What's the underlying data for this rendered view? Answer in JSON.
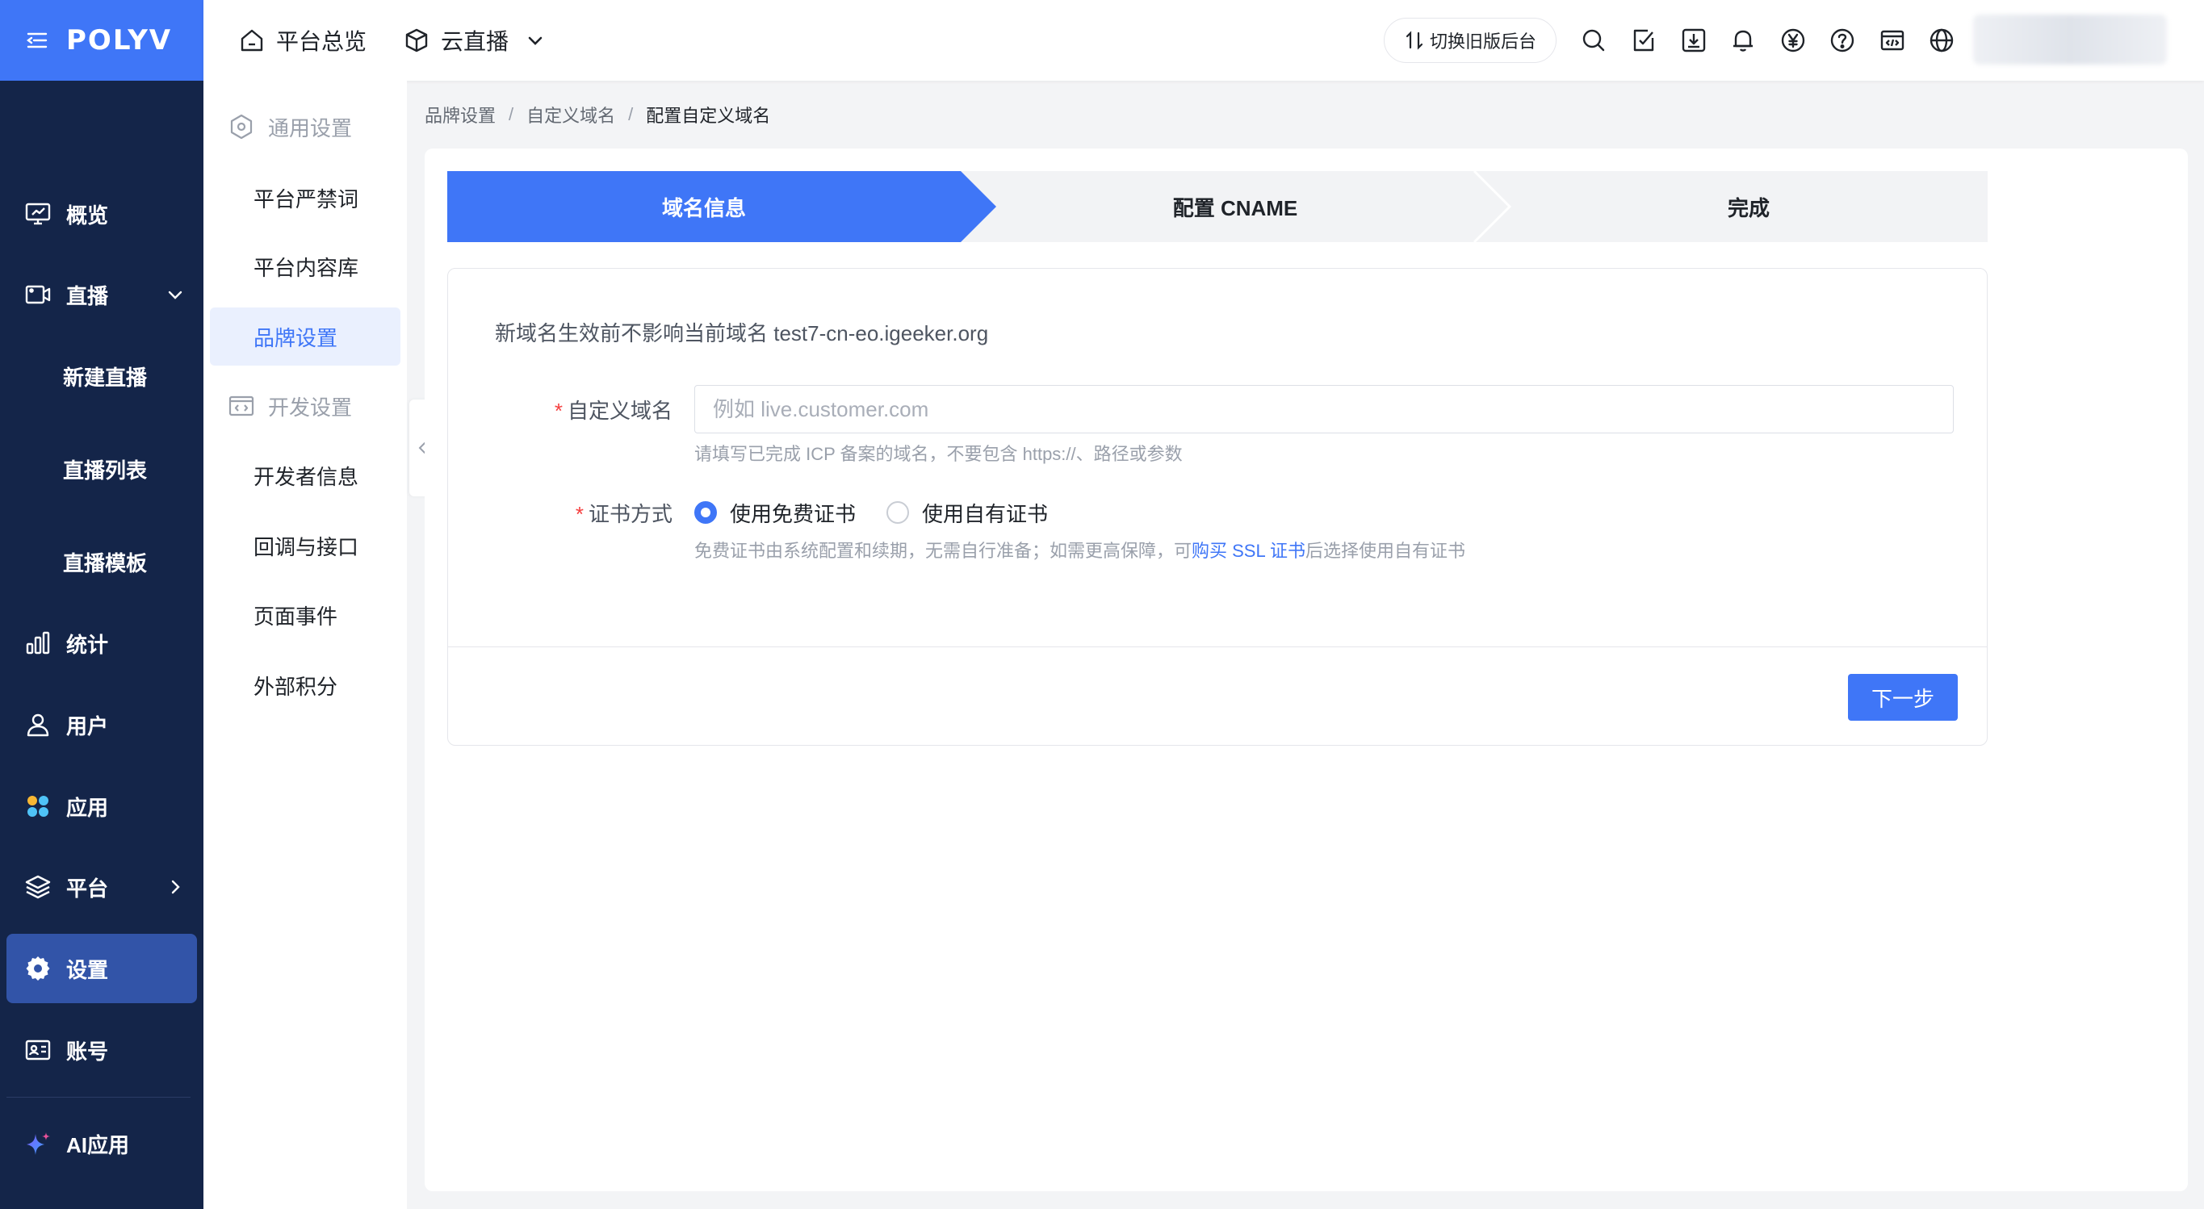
{
  "brand": {
    "logo_text": "POLYV"
  },
  "sidebar": {
    "items": [
      {
        "label": "概览",
        "icon": "monitor-chart-icon"
      },
      {
        "label": "直播",
        "icon": "video-icon"
      },
      {
        "label": "新建直播"
      },
      {
        "label": "直播列表"
      },
      {
        "label": "直播模板"
      },
      {
        "label": "统计",
        "icon": "bar-chart-icon"
      },
      {
        "label": "用户",
        "icon": "user-icon"
      },
      {
        "label": "应用",
        "icon": "apps-icon"
      },
      {
        "label": "平台",
        "icon": "layers-icon"
      },
      {
        "label": "设置",
        "icon": "gear-icon",
        "active": true
      },
      {
        "label": "账号",
        "icon": "id-card-icon"
      },
      {
        "label": "AI应用",
        "icon": "sparkle-icon"
      }
    ]
  },
  "header": {
    "overview_label": "平台总览",
    "product_label": "云直播",
    "switch_label": "切换旧版后台"
  },
  "submenu": {
    "group_general": "通用设置",
    "items_general": [
      "平台严禁词",
      "平台内容库",
      "品牌设置"
    ],
    "group_dev": "开发设置",
    "items_dev": [
      "开发者信息",
      "回调与接口",
      "页面事件",
      "外部积分"
    ],
    "active": "品牌设置"
  },
  "breadcrumb": [
    "品牌设置",
    "自定义域名",
    "配置自定义域名"
  ],
  "steps": [
    "域名信息",
    "配置 CNAME",
    "完成"
  ],
  "form": {
    "notice": "新域名生效前不影响当前域名 test7-cn-eo.igeeker.org",
    "domain_label": "自定义域名",
    "domain_placeholder": "例如 live.customer.com",
    "domain_value": "",
    "domain_help": "请填写已完成 ICP 备案的域名，不要包含 https://、路径或参数",
    "cert_label": "证书方式",
    "cert_options": [
      "使用免费证书",
      "使用自有证书"
    ],
    "cert_selected": "使用免费证书",
    "cert_help_prefix": "免费证书由系统配置和续期，无需自行准备；如需更高保障，可",
    "cert_help_link": "购买 SSL 证书",
    "cert_help_suffix": "后选择使用自有证书",
    "next_label": "下一步"
  },
  "colors": {
    "primary": "#3f76f7",
    "sidebar_bg": "#142549",
    "active_bg": "#3254a8",
    "required": "#f53f3f"
  }
}
